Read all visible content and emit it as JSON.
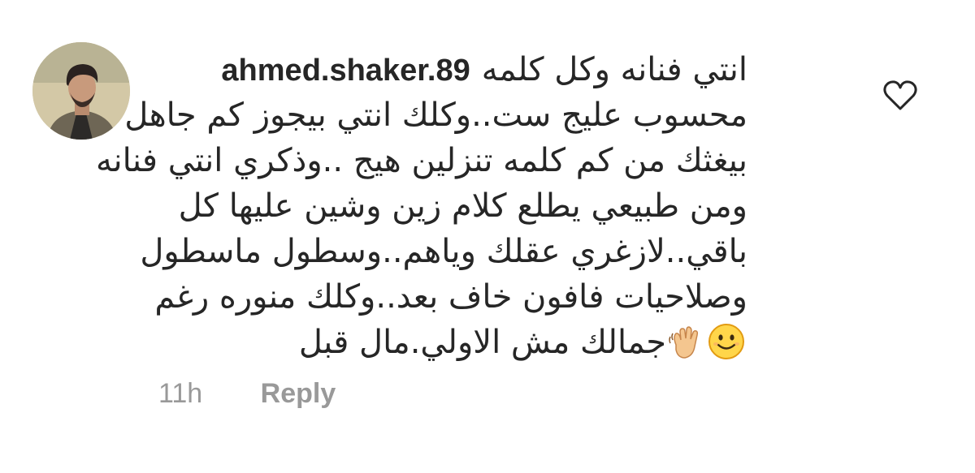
{
  "comment": {
    "username": "ahmed.shaker.89",
    "text_lines": [
      "انتي فنانه وكل كلمه",
      "محسوب عليج ست..وكلك انتي بيجوز كم جاهل",
      "بيغثك من كم كلمه تنزلين هيج ..وذكري انتي فنانه",
      "ومن طبيعي يطلع كلام زين وشين عليها كل",
      "باقي..لازغري عقلك وياهم..وسطول ماسطول",
      "وصلاحيات فافون خاف بعد..وكلك منوره رغم",
      "جمالك مش الاولي.مال قبل"
    ],
    "emojis": [
      "waving-hand-emoji",
      "smiling-face-emoji"
    ],
    "time": "11h",
    "reply_label": "Reply",
    "like_icon": "heart-outline-icon"
  },
  "colors": {
    "text": "#262626",
    "muted": "#999999",
    "background": "#ffffff"
  }
}
